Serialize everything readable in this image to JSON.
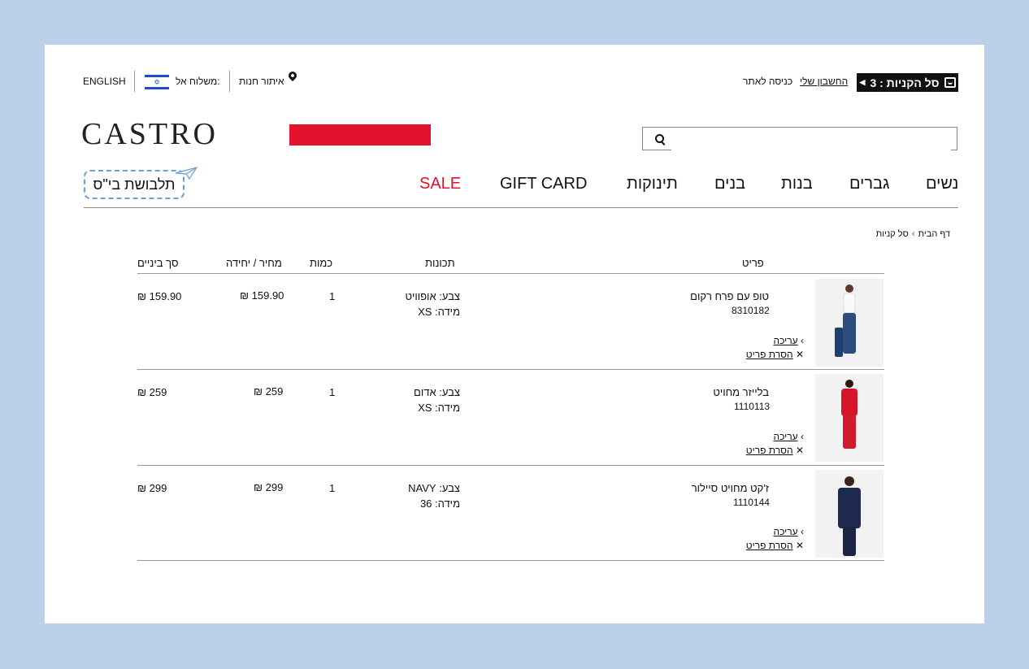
{
  "topbar": {
    "cart_label": "סל הקניות : 3",
    "account_link": "החשבון שלי",
    "login_link": "כניסה לאתר",
    "store_locator": "איתור חנות",
    "ship_to": "משלוח אל:",
    "language": "ENGLISH"
  },
  "logo": "CASTRO",
  "search": {
    "placeholder": ""
  },
  "nav": {
    "items": [
      "נשים",
      "גברים",
      "בנות",
      "בנים",
      "תינוקות",
      "GIFT CARD",
      "SALE"
    ],
    "sale_color": "#e3132e",
    "school_uniform": "תלבושת בי\"ס"
  },
  "breadcrumb": {
    "home": "דף הבית",
    "current": "סל קניות"
  },
  "table": {
    "headers": {
      "item": "פריט",
      "attributes": "תכונות",
      "qty": "כמות",
      "unit_price": "מחיר / יחידה",
      "subtotal": "סך ביניים"
    },
    "rows": [
      {
        "name": "טופ עם פרח רקום",
        "sku": "8310182",
        "color": "צבע: אופוויט",
        "size": "מידה: XS",
        "qty": "1",
        "unit_price": "₪ 159.90",
        "subtotal": "₪ 159.90",
        "edit": "עריכה",
        "remove": "הסרת פריט"
      },
      {
        "name": "בלייזר מחויט",
        "sku": "1110113",
        "color": "צבע: אדום",
        "size": "מידה: XS",
        "qty": "1",
        "unit_price": "₪ 259",
        "subtotal": "₪ 259",
        "edit": "עריכה",
        "remove": "הסרת פריט"
      },
      {
        "name": "ז'קט מחויט סיילור",
        "sku": "1110144",
        "color": "צבע: NAVY",
        "size": "מידה: 36",
        "qty": "1",
        "unit_price": "₪ 299",
        "subtotal": "₪ 299",
        "edit": "עריכה",
        "remove": "הסרת פריט"
      }
    ]
  },
  "colors": {
    "brand_red": "#e3132e",
    "background": "#bdd0ea"
  }
}
